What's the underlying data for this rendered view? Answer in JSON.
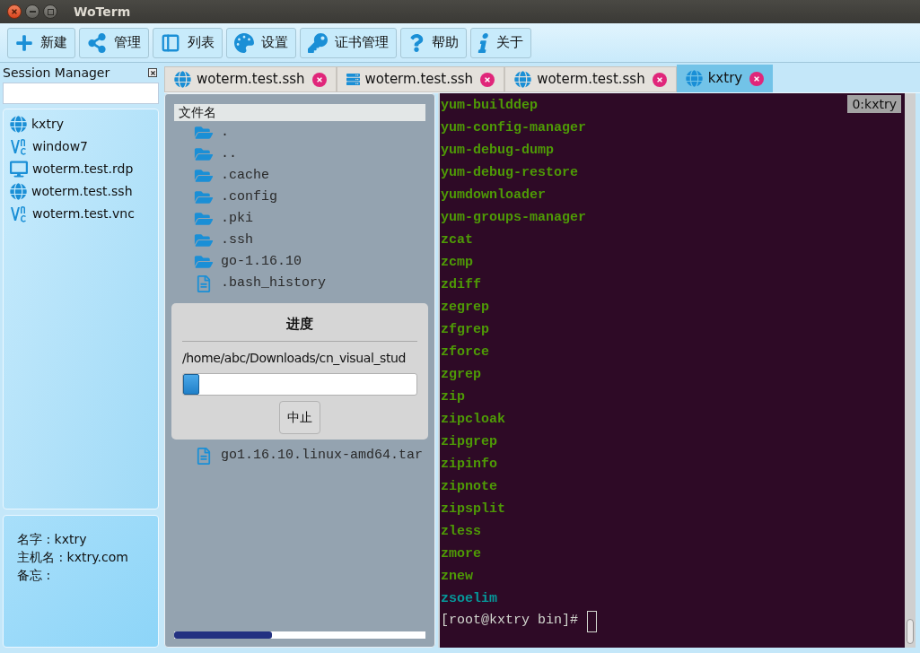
{
  "window": {
    "title": "WoTerm"
  },
  "toolbar": [
    {
      "kind": "new",
      "label": "新建"
    },
    {
      "kind": "manage",
      "label": "管理"
    },
    {
      "kind": "list",
      "label": "列表"
    },
    {
      "kind": "settings",
      "label": "设置"
    },
    {
      "kind": "cert",
      "label": "证书管理"
    },
    {
      "kind": "help",
      "label": "帮助"
    },
    {
      "kind": "about",
      "label": "关于"
    }
  ],
  "session_manager": {
    "title": "Session Manager",
    "sessions": [
      {
        "kind": "ssh",
        "name": "kxtry"
      },
      {
        "kind": "vnc",
        "name": "window7"
      },
      {
        "kind": "rdp",
        "name": "woterm.test.rdp"
      },
      {
        "kind": "ssh",
        "name": "woterm.test.ssh"
      },
      {
        "kind": "vnc",
        "name": "woterm.test.vnc"
      }
    ],
    "details": [
      "名字 : kxtry",
      "主机名 : kxtry.com",
      "备忘 :"
    ]
  },
  "tabs": [
    {
      "kind": "ssh",
      "label": "woterm.test.ssh",
      "selected": false
    },
    {
      "kind": "server",
      "label": "woterm.test.ssh",
      "selected": false
    },
    {
      "kind": "ssh",
      "label": "woterm.test.ssh",
      "selected": false
    },
    {
      "kind": "ssh",
      "label": "kxtry",
      "selected": true
    }
  ],
  "file_browser": {
    "column": "文件名",
    "rows": [
      {
        "kind": "folder",
        "name": "."
      },
      {
        "kind": "folder",
        "name": ".."
      },
      {
        "kind": "folder",
        "name": ".cache"
      },
      {
        "kind": "folder",
        "name": ".config"
      },
      {
        "kind": "folder",
        "name": ".pki"
      },
      {
        "kind": "folder",
        "name": ".ssh"
      },
      {
        "kind": "folder",
        "name": "go-1.16.10"
      },
      {
        "kind": "file",
        "name": ".bash_history"
      }
    ],
    "rows_below_dialog": [
      {
        "kind": "file",
        "name": "go1.16.10.linux-amd64.tar"
      }
    ],
    "transfer": {
      "level": 0.39
    }
  },
  "progress_dialog": {
    "title": "进度",
    "path": "/home/abc/Downloads/cn_visual_stud",
    "level": 0.07,
    "button": "中止"
  },
  "terminal": {
    "badge": "0:kxtry",
    "lines": [
      {
        "text": "yum-builddep",
        "kind": "executable"
      },
      {
        "text": "yum-config-manager",
        "kind": "executable"
      },
      {
        "text": "yum-debug-dump",
        "kind": "executable"
      },
      {
        "text": "yum-debug-restore",
        "kind": "executable"
      },
      {
        "text": "yumdownloader",
        "kind": "executable"
      },
      {
        "text": "yum-groups-manager",
        "kind": "executable"
      },
      {
        "text": "zcat",
        "kind": "executable"
      },
      {
        "text": "zcmp",
        "kind": "executable"
      },
      {
        "text": "zdiff",
        "kind": "executable"
      },
      {
        "text": "zegrep",
        "kind": "executable"
      },
      {
        "text": "zfgrep",
        "kind": "executable"
      },
      {
        "text": "zforce",
        "kind": "executable"
      },
      {
        "text": "zgrep",
        "kind": "executable"
      },
      {
        "text": "zip",
        "kind": "executable"
      },
      {
        "text": "zipcloak",
        "kind": "executable"
      },
      {
        "text": "zipgrep",
        "kind": "executable"
      },
      {
        "text": "zipinfo",
        "kind": "executable"
      },
      {
        "text": "zipnote",
        "kind": "executable"
      },
      {
        "text": "zipsplit",
        "kind": "executable"
      },
      {
        "text": "zless",
        "kind": "executable"
      },
      {
        "text": "zmore",
        "kind": "executable"
      },
      {
        "text": "znew",
        "kind": "executable"
      },
      {
        "text": "zsoelim",
        "kind": "link"
      }
    ],
    "prompt": "[root@kxtry bin]#"
  }
}
